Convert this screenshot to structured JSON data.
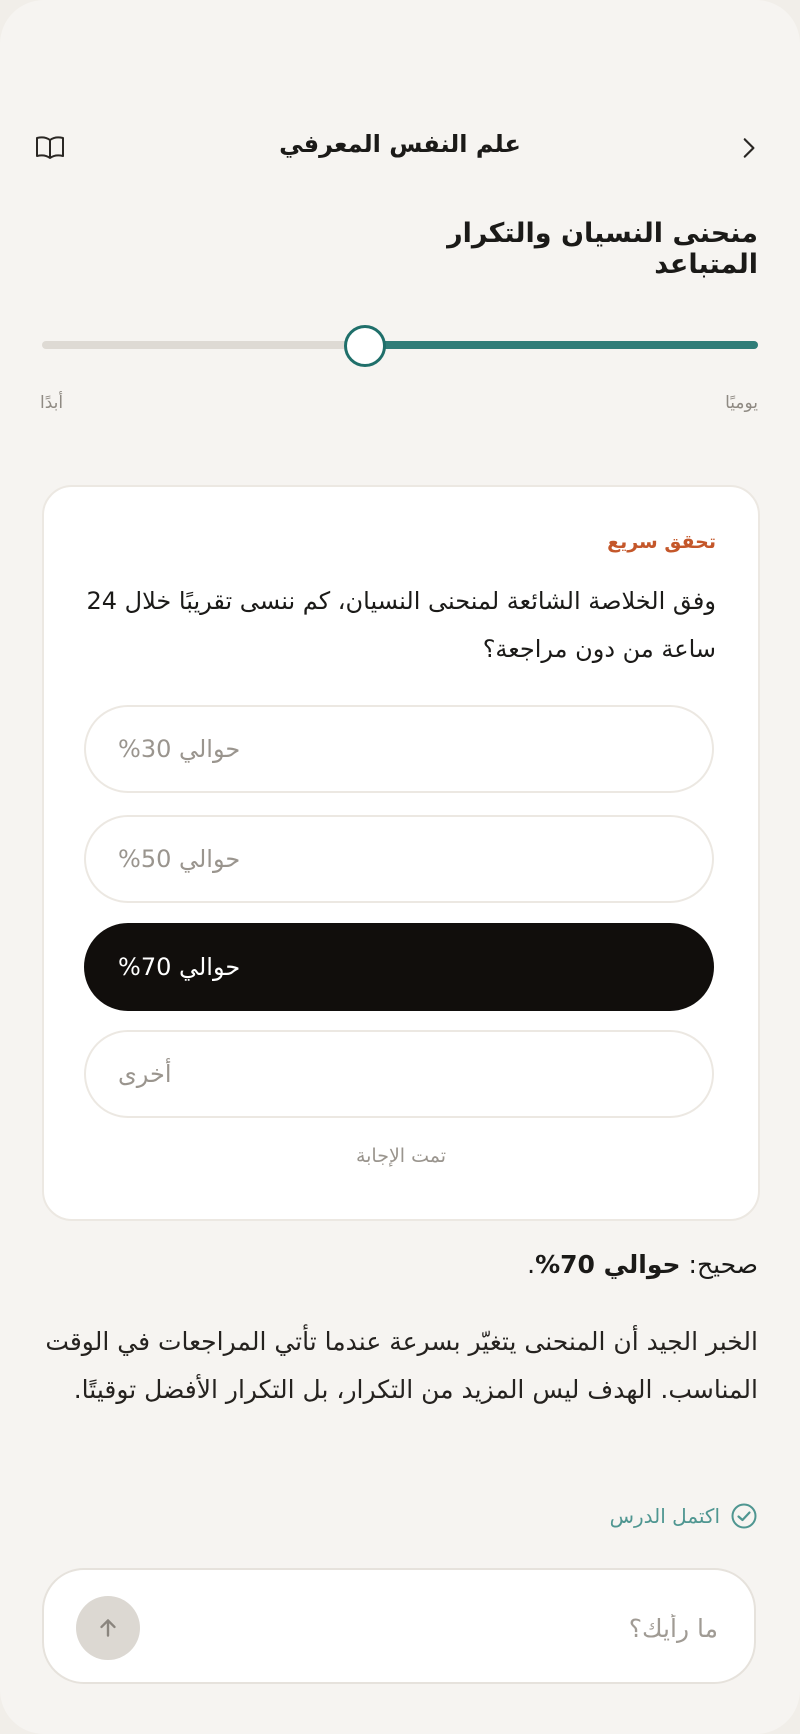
{
  "header": {
    "title": "علم النفس المعرفي",
    "back_icon": "chevron-right-icon",
    "book_icon": "book-open-icon"
  },
  "lesson": {
    "title": "منحنى النسيان والتكرار المتباعد"
  },
  "slider": {
    "value_fraction": 0.45,
    "label_right": "يوميًا",
    "label_left": "أبدًا",
    "accent_color": "#2f7d78"
  },
  "quiz": {
    "eyebrow": "تحقق سريع",
    "question": "وفق الخلاصة الشائعة لمنحنى النسيان، كم ننسى تقريبًا خلال 24 ساعة من دون مراجعة؟",
    "options": [
      {
        "label": "حوالي 30%",
        "selected": false
      },
      {
        "label": "حوالي 50%",
        "selected": false
      },
      {
        "label": "حوالي 70%",
        "selected": true
      },
      {
        "label": "أخرى",
        "selected": false
      }
    ],
    "status": "تمت الإجابة"
  },
  "feedback": {
    "prefix": "صحيح: ",
    "answer": "حوالي 70%",
    "suffix": ".",
    "explanation": "الخبر الجيد أن المنحنى يتغيّر بسرعة عندما تأتي المراجعات في الوقت المناسب. الهدف ليس المزيد من التكرار، بل التكرار الأفضل توقيتًا."
  },
  "completion": {
    "label": "اكتمل الدرس",
    "color": "#4f9691"
  },
  "composer": {
    "placeholder": "ما رأيك؟",
    "send_icon": "arrow-up-icon"
  }
}
